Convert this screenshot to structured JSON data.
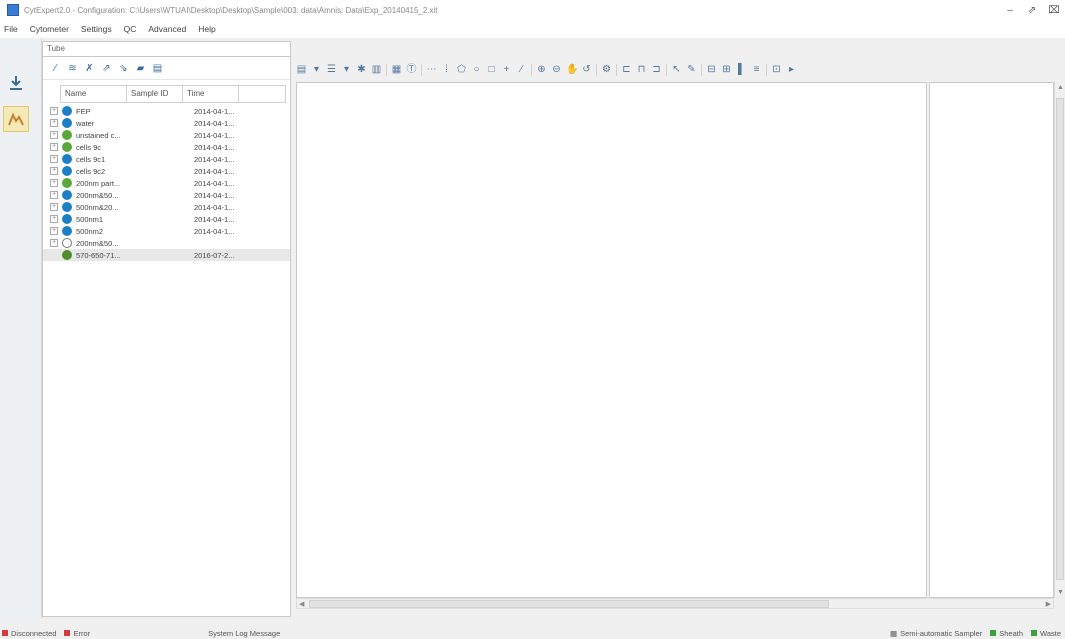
{
  "window": {
    "title": "CytExpert2.0 - Configuration: C:\\Users\\WTUAI\\Desktop\\Desktop\\Sample\\003: data\\Amnis: Data\\Exp_20140415_2.xit",
    "minimize": "–",
    "maximize": "⇗",
    "close": "⌧"
  },
  "menu": [
    "File",
    "Cytometer",
    "Settings",
    "QC",
    "Advanced",
    "Help"
  ],
  "panel": {
    "title": "Tube",
    "columns": {
      "name": "Name",
      "sample_id": "Sample ID",
      "time": "Time"
    },
    "rows": [
      {
        "name": "FEP",
        "time": "2014-04-1...",
        "dot_color": "#1c7fc4",
        "expander": "+"
      },
      {
        "name": "water",
        "time": "2014-04-1...",
        "dot_color": "#1c7fc4",
        "expander": "+"
      },
      {
        "name": "unstained c...",
        "time": "2014-04-1...",
        "dot_color": "#5aa83a",
        "expander": "+"
      },
      {
        "name": "cells 9c",
        "time": "2014-04-1...",
        "dot_color": "#5aa83a",
        "expander": "+"
      },
      {
        "name": "cells 9c1",
        "time": "2014-04-1...",
        "dot_color": "#1c7fc4",
        "expander": "+"
      },
      {
        "name": "cells 9c2",
        "time": "2014-04-1...",
        "dot_color": "#1c7fc4",
        "expander": "+"
      },
      {
        "name": "200nm part...",
        "time": "2014-04-1...",
        "dot_color": "#5aa83a",
        "expander": "+"
      },
      {
        "name": "200nm&50...",
        "time": "2014-04-1...",
        "dot_color": "#1c7fc4",
        "expander": "+"
      },
      {
        "name": "500nm&20...",
        "time": "2014-04-1...",
        "dot_color": "#1c7fc4",
        "expander": "+"
      },
      {
        "name": "500nm1",
        "time": "2014-04-1...",
        "dot_color": "#1c7fc4",
        "expander": "+"
      },
      {
        "name": "500nm2",
        "time": "2014-04-1...",
        "dot_color": "#1c7fc4",
        "expander": "+"
      },
      {
        "name": "200nm&50...",
        "time": "",
        "dot_color": "#ffffff",
        "expander": "+"
      },
      {
        "name": "570-650-71...",
        "time": "2016-07-2...",
        "dot_color": "#4c8f2a",
        "expander": ""
      }
    ]
  },
  "status": {
    "disconnected": "Disconnected",
    "error": "Error",
    "system_log": "System Log Message",
    "sampler": "Semi-automatic Sampler",
    "sheath": "Sheath",
    "waste": "Waste"
  },
  "colors": {
    "status_red": "#d43b3b",
    "status_green": "#3fa03f"
  }
}
